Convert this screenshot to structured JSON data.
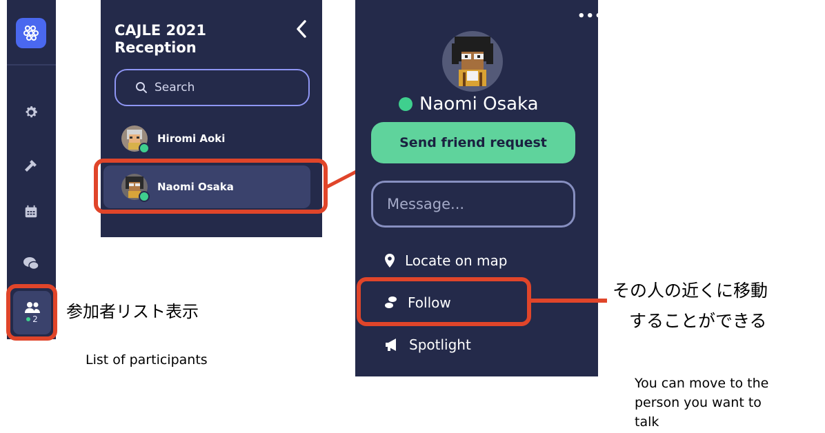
{
  "sidebar": {
    "people_count": "2"
  },
  "list_panel": {
    "title_line1": "CAJLE 2021",
    "title_line2": "Reception",
    "search_placeholder": "Search",
    "participants": [
      {
        "name": "Hiromi Aoki"
      },
      {
        "name": "Naomi Osaka"
      }
    ]
  },
  "profile": {
    "more_label": "•••",
    "name": "Naomi Osaka",
    "friend_button": "Send friend request",
    "message_placeholder": "Message...",
    "actions": {
      "locate": "Locate on map",
      "follow": "Follow",
      "spotlight": "Spotlight"
    }
  },
  "annotations": {
    "participants_jp": "参加者リスト表示",
    "participants_en": "List of participants",
    "follow_jp_line1": "その人の近くに移動",
    "follow_jp_line2": "することができる",
    "follow_en_line1": "You can move to the",
    "follow_en_line2": "person you want to",
    "follow_en_line3": "talk"
  },
  "colors": {
    "panel": "#242a4a",
    "highlight": "#e0452a",
    "accent_green": "#5fd39c",
    "online": "#3fcf8e",
    "logo_blue": "#4a68ef"
  }
}
